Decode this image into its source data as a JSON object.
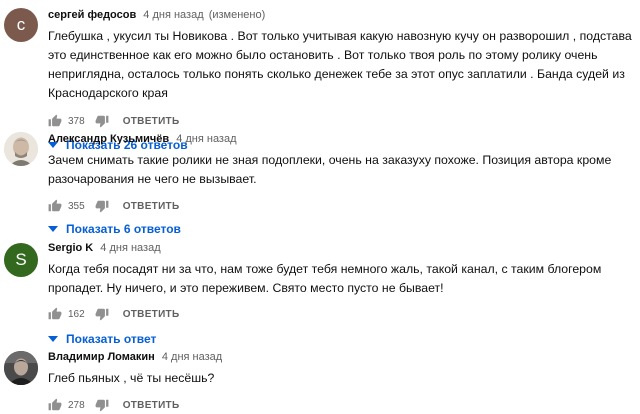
{
  "comments": [
    {
      "author": "сергей федосов",
      "time": "4 дня назад",
      "edited": "(изменено)",
      "avatar_letter": "с",
      "avatar_color": "#7b5a4d",
      "text": "Глебушка , укусил ты Новикова . Вот только учитывая какую навозную кучу он разворошил , подстава это единственное как его можно было остановить . Вот только твоя роль по этому ролику очень неприглядна, осталось только понять сколько денежек тебе за этот опус заплатили . Банда судей из Краснодарского края",
      "likes": "378",
      "reply_label": "ОТВЕТИТЬ",
      "replies_label": "Показать 26 ответов"
    },
    {
      "author": "Александр Кузьмичёв",
      "time": "4 дня назад",
      "avatar_icon": "person-photo-icon",
      "text": "Зачем снимать такие ролики не зная подоплеки, очень на заказуху похоже. Позиция автора кроме разочарования не чего не вызывает.",
      "likes": "355",
      "reply_label": "ОТВЕТИТЬ",
      "replies_label": "Показать 6 ответов"
    },
    {
      "author": "Sergio K",
      "time": "4 дня назад",
      "avatar_letter": "S",
      "avatar_color": "#33691e",
      "text": "Когда тебя посадят ни за что, нам тоже  будет тебя немного жаль, такой канал, с таким блогером пропадет. Ну ничего, и это переживем. Свято место пусто не бывает!",
      "likes": "162",
      "reply_label": "ОТВЕТИТЬ",
      "replies_label": "Показать ответ"
    },
    {
      "author": "Владимир Ломакин",
      "time": "4 дня назад",
      "avatar_icon": "person-photo-icon",
      "text": "Глеб пьяных , чё ты несёшь?",
      "likes": "278",
      "reply_label": "ОТВЕТИТЬ"
    }
  ],
  "colors": {
    "link_blue": "#065fd4",
    "secondary_text": "#606060"
  }
}
